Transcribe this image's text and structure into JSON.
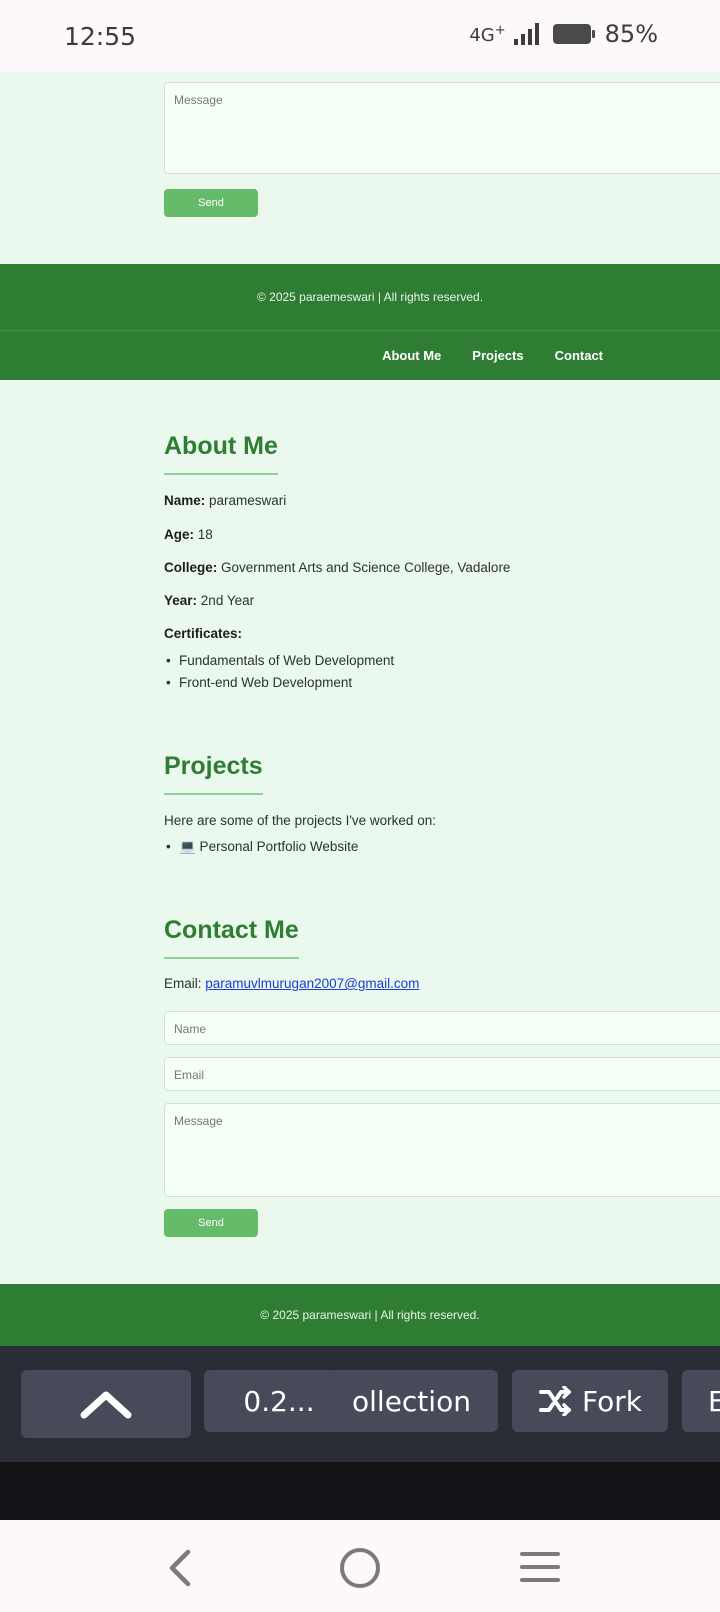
{
  "status_bar": {
    "time": "12:55",
    "network": "4G",
    "network_plus": "+",
    "battery": "85%"
  },
  "top_form": {
    "message_placeholder": "Message",
    "send_label": "Send"
  },
  "footer_top": {
    "copyright": "© 2025 paraemeswari | All rights reserved."
  },
  "nav": {
    "items": [
      "About Me",
      "Projects",
      "Contact"
    ]
  },
  "about": {
    "title": "About Me",
    "name_label": "Name:",
    "name_value": "parameswari",
    "age_label": "Age:",
    "age_value": "18",
    "college_label": "College:",
    "college_value": "Government Arts and Science College, Vadalore",
    "year_label": "Year:",
    "year_value": "2nd Year",
    "certificates_label": "Certificates:",
    "certificates": [
      "Fundamentals of Web Development",
      "Front-end Web Development"
    ]
  },
  "projects": {
    "title": "Projects",
    "intro": "Here are some of the projects I've worked on:",
    "items": [
      "💻 Personal Portfolio Website"
    ]
  },
  "contact": {
    "title": "Contact Me",
    "email_label": "Email:",
    "email": "paramuvlmurugan2007@gmail.com",
    "name_placeholder": "Name",
    "email_placeholder": "Email",
    "message_placeholder": "Message",
    "send_label": "Send"
  },
  "footer_bottom": {
    "copyright": "© 2025 parameswari | All rights reserved."
  },
  "toolbar": {
    "version_chip": "0.2...",
    "collection_chip": "ollection",
    "fork_chip": "Fork",
    "more_chip": "E"
  },
  "colors": {
    "green_dark": "#2e7d32",
    "green_button": "#66bb6a",
    "page_bg": "#eaf8ee"
  }
}
